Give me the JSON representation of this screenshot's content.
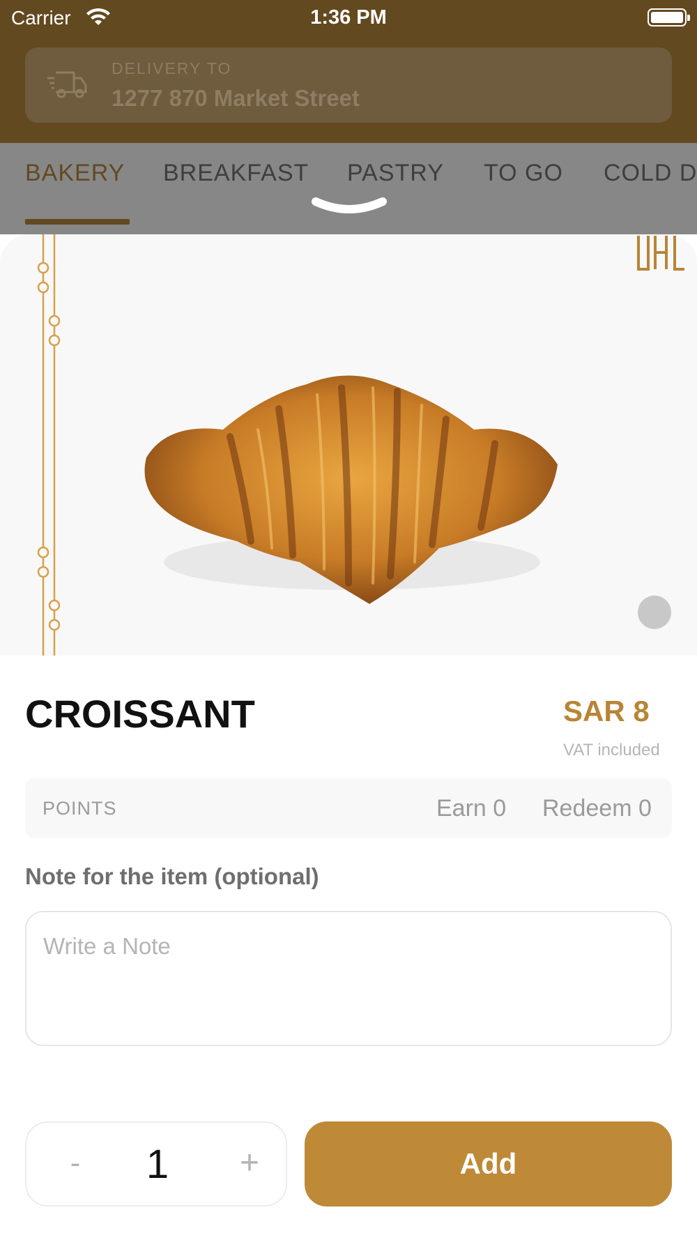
{
  "status_bar": {
    "carrier": "Carrier",
    "time": "1:36 PM"
  },
  "delivery": {
    "label": "DELIVERY TO",
    "address": "1277 870 Market Street"
  },
  "categories": [
    {
      "label": "BAKERY",
      "active": true
    },
    {
      "label": "BREAKFAST",
      "active": false
    },
    {
      "label": "PASTRY",
      "active": false
    },
    {
      "label": "TO GO",
      "active": false
    },
    {
      "label": "COLD D",
      "active": false
    }
  ],
  "product": {
    "name": "CROISSANT",
    "price": "SAR 8",
    "vat_note": "VAT included"
  },
  "points": {
    "label": "POINTS",
    "earn": "Earn 0",
    "redeem": "Redeem 0"
  },
  "note": {
    "label": "Note for the item (optional)",
    "placeholder": "Write a Note",
    "value": ""
  },
  "quantity": {
    "minus": "-",
    "value": "1",
    "plus": "+"
  },
  "actions": {
    "add_label": "Add"
  },
  "colors": {
    "brand": "#be8a37",
    "header": "#634920",
    "overlay_tabs": "#878787"
  },
  "icons": [
    "wifi-icon",
    "battery-icon",
    "delivery-truck-icon",
    "brand-logo",
    "sheet-grabber-icon"
  ]
}
